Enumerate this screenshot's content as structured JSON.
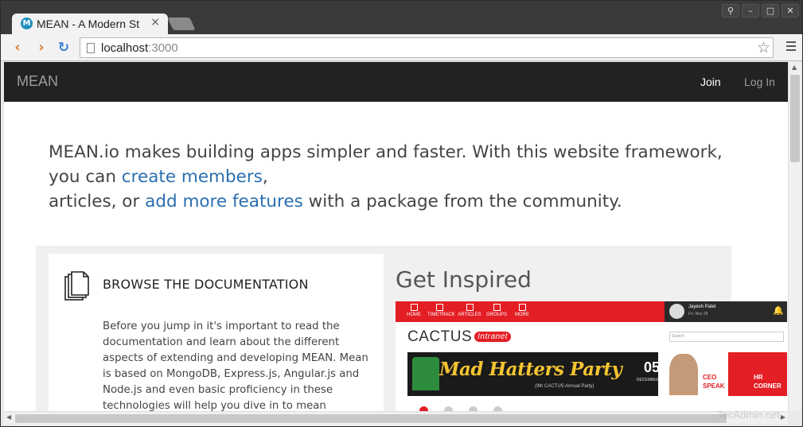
{
  "browser": {
    "tab_title": "MEAN - A Modern St",
    "tab_favicon_letter": "M",
    "tab_close": "×",
    "url_host": "localhost",
    "url_port": ":3000"
  },
  "navbar": {
    "brand": "MEAN",
    "join": "Join",
    "login": "Log In"
  },
  "lead": {
    "part1": "MEAN.io makes building apps simpler and faster. With this website framework, you can ",
    "link1": "create members",
    "part2": ",",
    "part3": "articles, or ",
    "link2": "add more features",
    "part4": " with a package from the community."
  },
  "docs": {
    "heading": "BROWSE THE DOCUMENTATION",
    "body": "Before you jump in it's important to read the documentation and learn about the different aspects of extending and developing MEAN. Mean is based on MongoDB, Express.js, Angular.js and Node.js and even basic proficiency in these technologies will help you dive in to mean"
  },
  "inspired": {
    "heading": "Get Inspired",
    "nav": [
      "HOME",
      "TIMETRACK",
      "ARTICLES",
      "GROUPS",
      "MORE"
    ],
    "user_name": "Jayesh Patel",
    "user_date": "Fri, Nov 28",
    "logo": "CACTUS",
    "logo_sub": "Intranet",
    "search_placeholder": "Search",
    "banner_title": "Mad Hatters Party",
    "banner_sub": "(9th CACTUS Annual Party)",
    "banner_day": "05",
    "banner_month": "DECEMBER",
    "ceo_label": "CEO SPEAK",
    "hr_label": "HR CORNER"
  },
  "watermark": "TecAdmin.net",
  "colors": {
    "navbar_bg": "#222222",
    "link": "#2a6fb0",
    "accent_red": "#e31e24"
  }
}
